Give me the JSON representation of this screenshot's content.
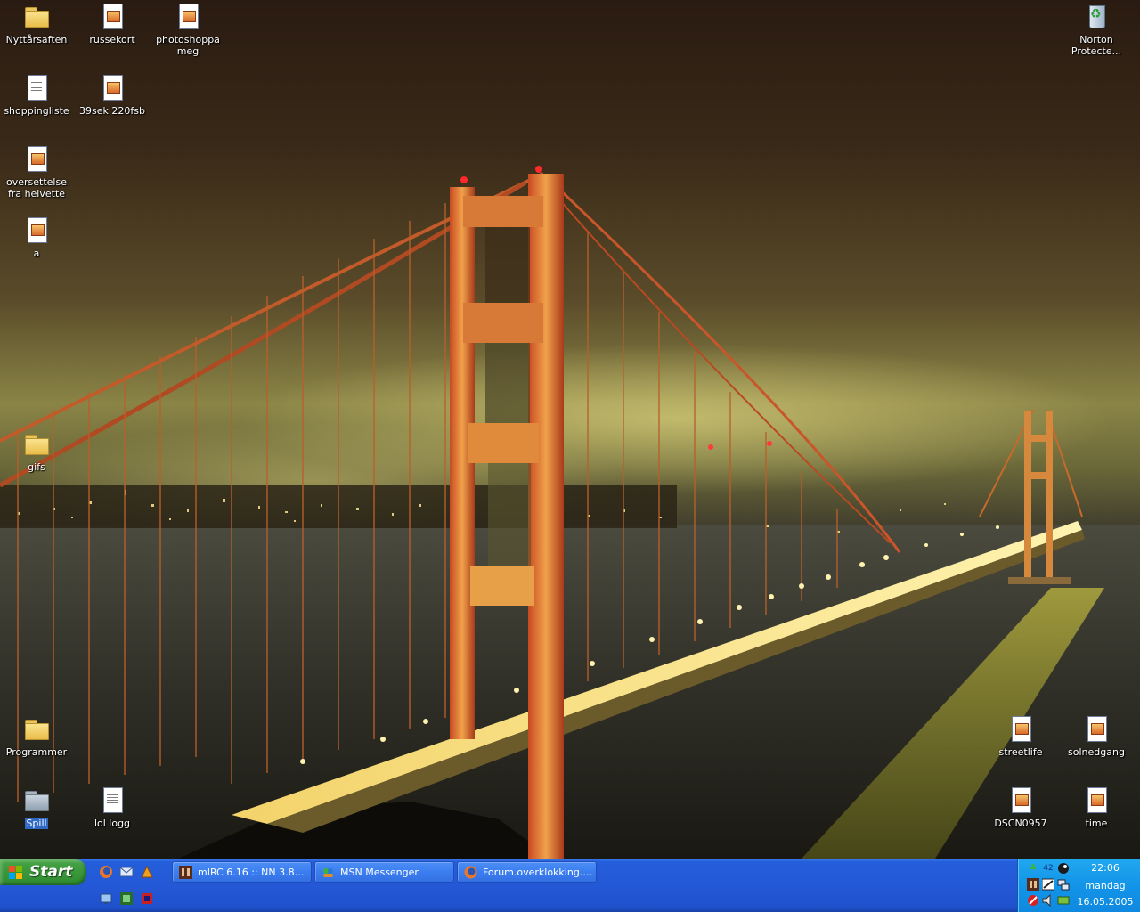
{
  "desktop": {
    "icons": {
      "nyttarsaften": {
        "label": "Nyttårsaften",
        "icon": "folder-icon"
      },
      "russekort": {
        "label": "russekort",
        "icon": "image-file-icon"
      },
      "photoshoppa_meg": {
        "label": "photoshoppa meg",
        "icon": "image-file-icon"
      },
      "norton": {
        "label": "Norton Protecte...",
        "icon": "recycle-bin-icon"
      },
      "shoppingliste": {
        "label": "shoppingliste",
        "icon": "text-file-icon"
      },
      "sek220fsb": {
        "label": "39sek 220fsb",
        "icon": "image-file-icon"
      },
      "oversettelse": {
        "label": "oversettelse fra helvette",
        "icon": "image-file-icon"
      },
      "a": {
        "label": "a",
        "icon": "image-file-icon"
      },
      "gifs": {
        "label": "gifs",
        "icon": "folder-icon"
      },
      "programmer": {
        "label": "Programmer",
        "icon": "folder-icon"
      },
      "spill": {
        "label": "Spill",
        "icon": "folder-icon",
        "selected": true
      },
      "lol_logg": {
        "label": "lol logg",
        "icon": "text-file-icon"
      },
      "streetlife": {
        "label": "streetlife",
        "icon": "image-file-icon"
      },
      "solnedgang": {
        "label": "solnedgang",
        "icon": "image-file-icon"
      },
      "dscn0957": {
        "label": "DSCN0957",
        "icon": "image-file-icon"
      },
      "time": {
        "label": "time",
        "icon": "image-file-icon"
      }
    }
  },
  "taskbar": {
    "start_label": "Start",
    "quick_launch": [
      "firefox-icon",
      "email-icon",
      "winamp-icon",
      "desktop-icon",
      "app-icon",
      "game-icon"
    ],
    "tasks": [
      {
        "label": "mIRC 6.16 :: NN 3.81...",
        "icon": "mirc-icon"
      },
      {
        "label": "MSN Messenger",
        "icon": "msn-icon"
      },
      {
        "label": "Forum.overklokking.n...",
        "icon": "firefox-icon"
      }
    ],
    "tray": {
      "badge": "42",
      "time": "22:06",
      "day": "mandag",
      "date": "16.05.2005"
    }
  },
  "colors": {
    "taskbar": "#245edb",
    "start_button": "#3c9a3c",
    "tray": "#1294e8",
    "selection": "#316ac5"
  }
}
